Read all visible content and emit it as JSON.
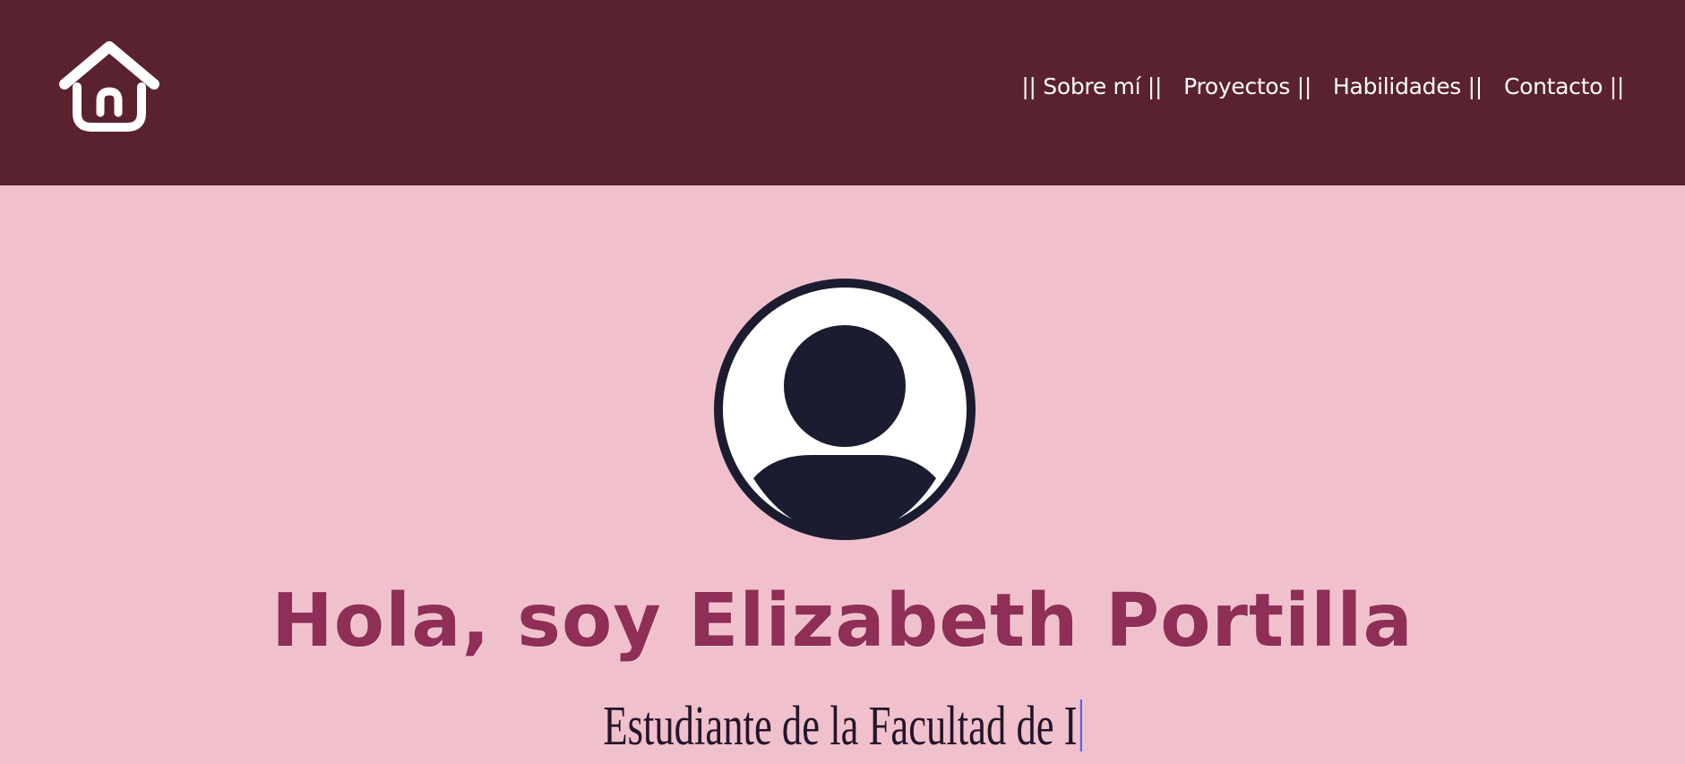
{
  "header": {
    "logo_icon": "home-icon",
    "nav": [
      {
        "label": "|| Sobre mí ||"
      },
      {
        "label": "Proyectos ||"
      },
      {
        "label": "Habilidades ||"
      },
      {
        "label": "Contacto ||"
      }
    ]
  },
  "hero": {
    "avatar_icon": "user-avatar-icon",
    "title": "Hola, soy Elizabeth Portilla",
    "subtitle": "Estudiante de la Facultad de I"
  },
  "colors": {
    "header_background": "#5a212f",
    "page_background": "#f0c1cd",
    "title_color": "#8f2e57",
    "subtitle_color": "#24152a",
    "cursor_color": "#4b63ff"
  }
}
